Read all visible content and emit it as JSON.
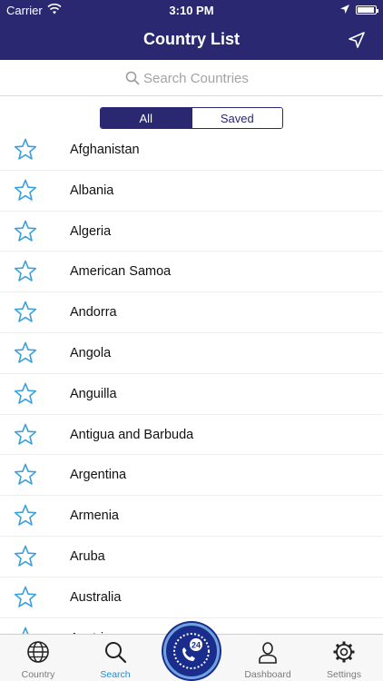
{
  "status": {
    "carrier": "Carrier",
    "time": "3:10 PM",
    "battery_level": 0.95
  },
  "navbar": {
    "title": "Country List",
    "right_icon": "location-arrow-icon"
  },
  "search": {
    "placeholder": "Search Countries",
    "value": ""
  },
  "segments": {
    "items": [
      "All",
      "Saved"
    ],
    "selected": "All"
  },
  "countries": [
    "Afghanistan",
    "Albania",
    "Algeria",
    "American Samoa",
    "Andorra",
    "Angola",
    "Anguilla",
    "Antigua and Barbuda",
    "Argentina",
    "Armenia",
    "Aruba",
    "Australia",
    "Austria"
  ],
  "tabbar": {
    "items": [
      {
        "label": "Country",
        "icon": "globe-icon",
        "active": false
      },
      {
        "label": "Search",
        "icon": "search-icon",
        "active": true
      },
      {
        "label": "",
        "icon": "24h-call-icon",
        "active": false
      },
      {
        "label": "Dashboard",
        "icon": "user-icon",
        "active": false
      },
      {
        "label": "Settings",
        "icon": "gear-icon",
        "active": false
      }
    ],
    "center_badge": "24"
  },
  "colors": {
    "primary": "#2a2870",
    "star": "#3aa0db",
    "active_tab": "#1e8ed6"
  }
}
